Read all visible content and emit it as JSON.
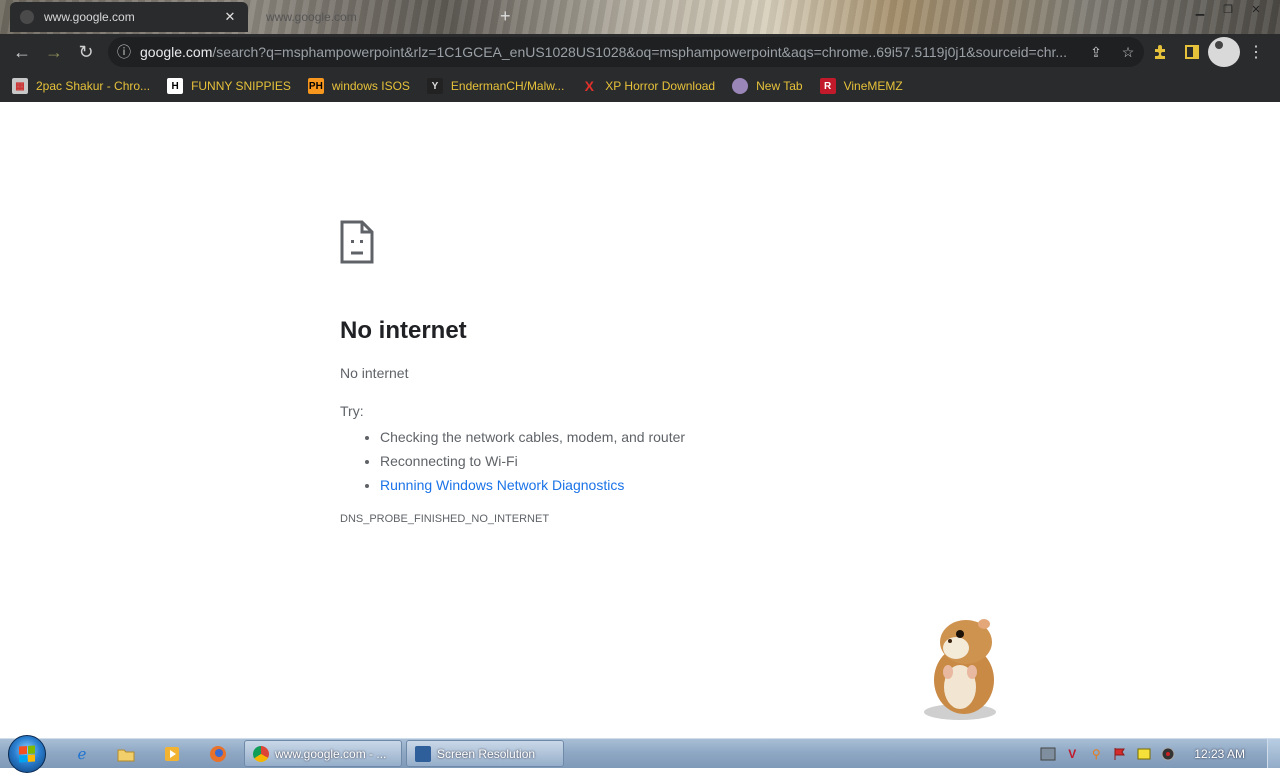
{
  "browser": {
    "tabs": [
      {
        "title": "www.google.com",
        "active": true
      },
      {
        "title": "www.google.com",
        "active": false
      }
    ],
    "new_tab_glyph": "+",
    "url_host": "google.com",
    "url_rest": "/search?q=msphampowerpoint&rlz=1C1GCEA_enUS1028US1028&oq=msphampowerpoint&aqs=chrome..69i57.5119j0j1&sourceid=chr...",
    "bookmarks": [
      {
        "label": "2pac Shakur - Chro...",
        "icon": "calendar-icon"
      },
      {
        "label": "FUNNY SNIPPIES",
        "icon": "H"
      },
      {
        "label": "windows ISOS",
        "icon": "PH"
      },
      {
        "label": "EndermanCH/Malw...",
        "icon": "Y"
      },
      {
        "label": "XP Horror Download",
        "icon": "X"
      },
      {
        "label": "New Tab",
        "icon": "globe-icon"
      },
      {
        "label": "VineMEMZ",
        "icon": "R"
      }
    ]
  },
  "page": {
    "heading": "No internet",
    "subtext": "No internet",
    "try_label": "Try:",
    "suggestions": [
      "Checking the network cables, modem, and router",
      "Reconnecting to Wi-Fi"
    ],
    "diagnostics_link": "Running Windows Network Diagnostics",
    "error_code": "DNS_PROBE_FINISHED_NO_INTERNET"
  },
  "taskbar": {
    "tasks": [
      {
        "label": "www.google.com - ..."
      },
      {
        "label": "Screen Resolution"
      }
    ],
    "clock": "12:23 AM"
  },
  "colors": {
    "chrome_dark": "#2a2b2d",
    "bookmark_text": "#e6c23a",
    "link": "#1a73e8"
  }
}
